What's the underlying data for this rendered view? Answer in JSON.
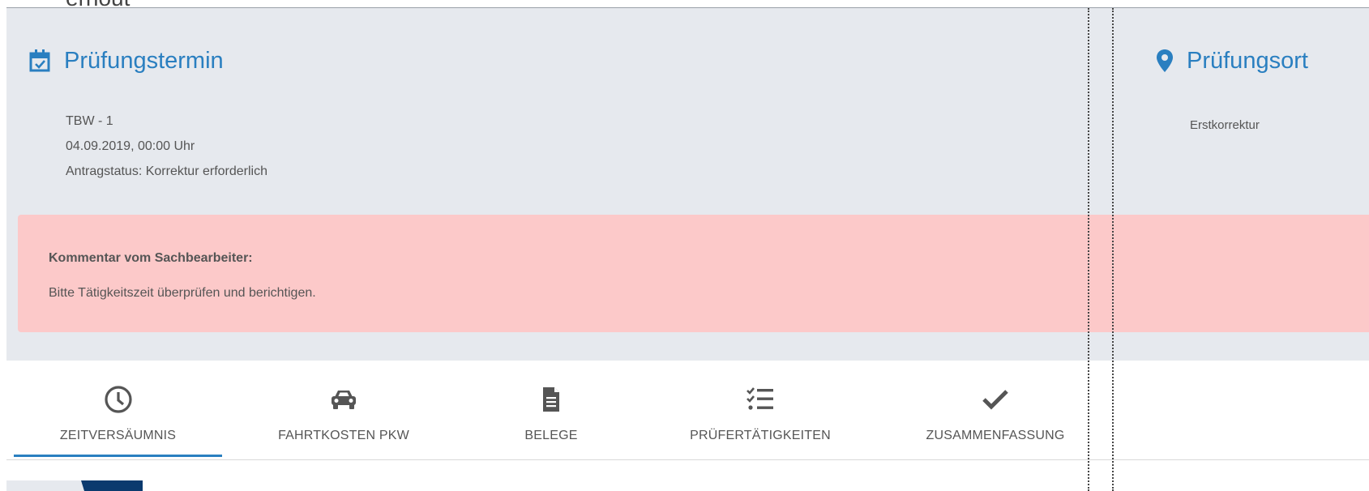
{
  "page": {
    "cutoff_heading": "ernout"
  },
  "left_section": {
    "title": "Prüfungstermin",
    "icon": "calendar-check-icon",
    "lines": [
      "TBW - 1",
      "04.09.2019, 00:00 Uhr",
      "Antragstatus: Korrektur erforderlich"
    ]
  },
  "right_section": {
    "title": "Prüfungsort",
    "icon": "map-marker-icon",
    "subtitle": "Erstkorrektur"
  },
  "comment": {
    "title": "Kommentar vom Sachbearbeiter:",
    "text": "Bitte Tätigkeitszeit überprüfen und berichtigen."
  },
  "tabs": [
    {
      "label": "ZEITVERSÄUMNIS",
      "icon": "clock-icon",
      "active": true
    },
    {
      "label": "FAHRTKOSTEN PKW",
      "icon": "car-icon",
      "active": false
    },
    {
      "label": "BELEGE",
      "icon": "document-icon",
      "active": false
    },
    {
      "label": "PRÜFERTÄTIGKEITEN",
      "icon": "checklist-icon",
      "active": false
    },
    {
      "label": "ZUSAMMENFASSUNG",
      "icon": "checkmark-icon",
      "active": false
    }
  ],
  "colors": {
    "accent": "#2a7fc0",
    "panel_bg": "#e6e9ee",
    "comment_bg": "#fcc9c9",
    "text": "#555555",
    "logo_dark": "#0b3a6e"
  }
}
